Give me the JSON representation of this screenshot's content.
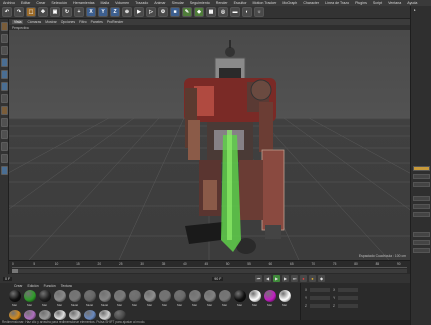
{
  "menubar": {
    "items": [
      "Archivo",
      "Editar",
      "Crear",
      "Selección",
      "Herramientas",
      "Malla",
      "Volumen",
      "Trazado",
      "Animar",
      "Simular",
      "Seguimiento",
      "Render",
      "Escultor",
      "Motion Tracker",
      "MoGraph",
      "Character",
      "Línea de Trazo",
      "Plugins",
      "Script",
      "Ventana",
      "Ayuda"
    ]
  },
  "toolbar": {
    "axis_x": "X",
    "axis_y": "Y",
    "axis_z": "Z"
  },
  "viewport": {
    "tabs": [
      "Vista",
      "Cámaras",
      "Mostrar",
      "Opciones",
      "Filtro",
      "Paneles",
      "ProRender"
    ],
    "active_tab": "Vista",
    "name": "Perspectiva",
    "status": "Espaciado Cuadrícula : 100 cm"
  },
  "timeline": {
    "ticks": [
      "0",
      "5",
      "10",
      "15",
      "20",
      "25",
      "30",
      "35",
      "40",
      "45",
      "50",
      "55",
      "60",
      "65",
      "70",
      "75",
      "80",
      "85",
      "90"
    ],
    "current_frame": "0 F",
    "end_frame": "90 F"
  },
  "materials": {
    "tabs": [
      "Crear",
      "Edición",
      "Función",
      "Textura"
    ],
    "row1": [
      {
        "label": "Mat",
        "color": "#111111"
      },
      {
        "label": "Mat",
        "color": "#2f9c2a"
      },
      {
        "label": "Mat",
        "color": "#1f1f1f"
      },
      {
        "label": "Mat",
        "color": "#8a8a8a"
      },
      {
        "label": "Metal",
        "color": "#777777"
      },
      {
        "label": "Metal",
        "color": "#666666"
      },
      {
        "label": "Metal",
        "color": "#858585"
      },
      {
        "label": "Mat",
        "color": "#7a7a7a"
      },
      {
        "label": "Mat",
        "color": "#6e6e6e"
      },
      {
        "label": "Mat",
        "color": "#8f8f8f"
      },
      {
        "label": "Mat",
        "color": "#737373"
      },
      {
        "label": "Mat",
        "color": "#696969"
      },
      {
        "label": "Mat",
        "color": "#7d7d7d"
      },
      {
        "label": "Mat",
        "color": "#828282"
      },
      {
        "label": "Mat",
        "color": "#777777"
      },
      {
        "label": "Mat",
        "color": "#101010"
      },
      {
        "label": "Mat",
        "color": "#ffffff"
      },
      {
        "label": "Mat",
        "color": "#c21ec2"
      },
      {
        "label": "Mat",
        "color": "#ffffff"
      }
    ],
    "row2": [
      {
        "color": "#d08a20"
      },
      {
        "color": "#b070c0"
      },
      {
        "color": "#9a9a9a"
      },
      {
        "color": "#e0e0e0"
      },
      {
        "color": "#c0c0c0"
      },
      {
        "color": "#6a8ac0"
      },
      {
        "color": "#d0d0d0"
      },
      {
        "color": "#4a4a4a"
      }
    ]
  },
  "status_line": "Redimensionar: Haz clic y arrastra para redimensionar elementos. Pulsa SHIFT para ajustar al modo."
}
